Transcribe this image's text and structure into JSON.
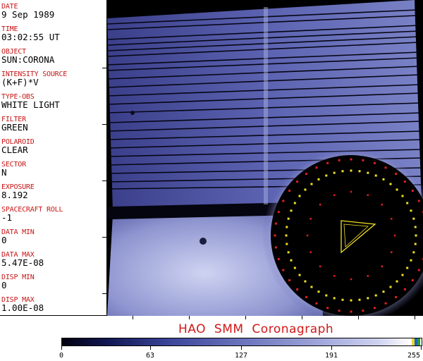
{
  "panel": {
    "date_label": "DATE",
    "date_value": "9 Sep 1989",
    "time_label": "TIME",
    "time_value": "03:02:55 UT",
    "object_label": "OBJECT",
    "object_value": "SUN:CORONA",
    "source_label": "INTENSITY SOURCE",
    "source_value": "(K+F)*V",
    "typeobs_label": "TYPE-OBS",
    "typeobs_value": "WHITE LIGHT",
    "filter_label": "FILTER",
    "filter_value": "GREEN",
    "polaroid_label": "POLAROID",
    "polaroid_value": "CLEAR",
    "sector_label": "SECTOR",
    "sector_value": "N",
    "exposure_label": "EXPOSURE",
    "exposure_value": "8.192",
    "roll_label": "SPACECRAFT ROLL",
    "roll_value": "-1",
    "datamin_label": "DATA MIN",
    "datamin_value": "0",
    "datamax_label": "DATA MAX",
    "datamax_value": "5.47E-08",
    "dispmin_label": "DISP MIN",
    "dispmin_value": "0",
    "dispmax_label": "DISP MAX",
    "dispmax_value": "1.00E-08"
  },
  "title": "HAO SMM Coronagraph",
  "colorbar": {
    "ticks": [
      "0",
      "63",
      "127",
      "191",
      "255"
    ]
  }
}
